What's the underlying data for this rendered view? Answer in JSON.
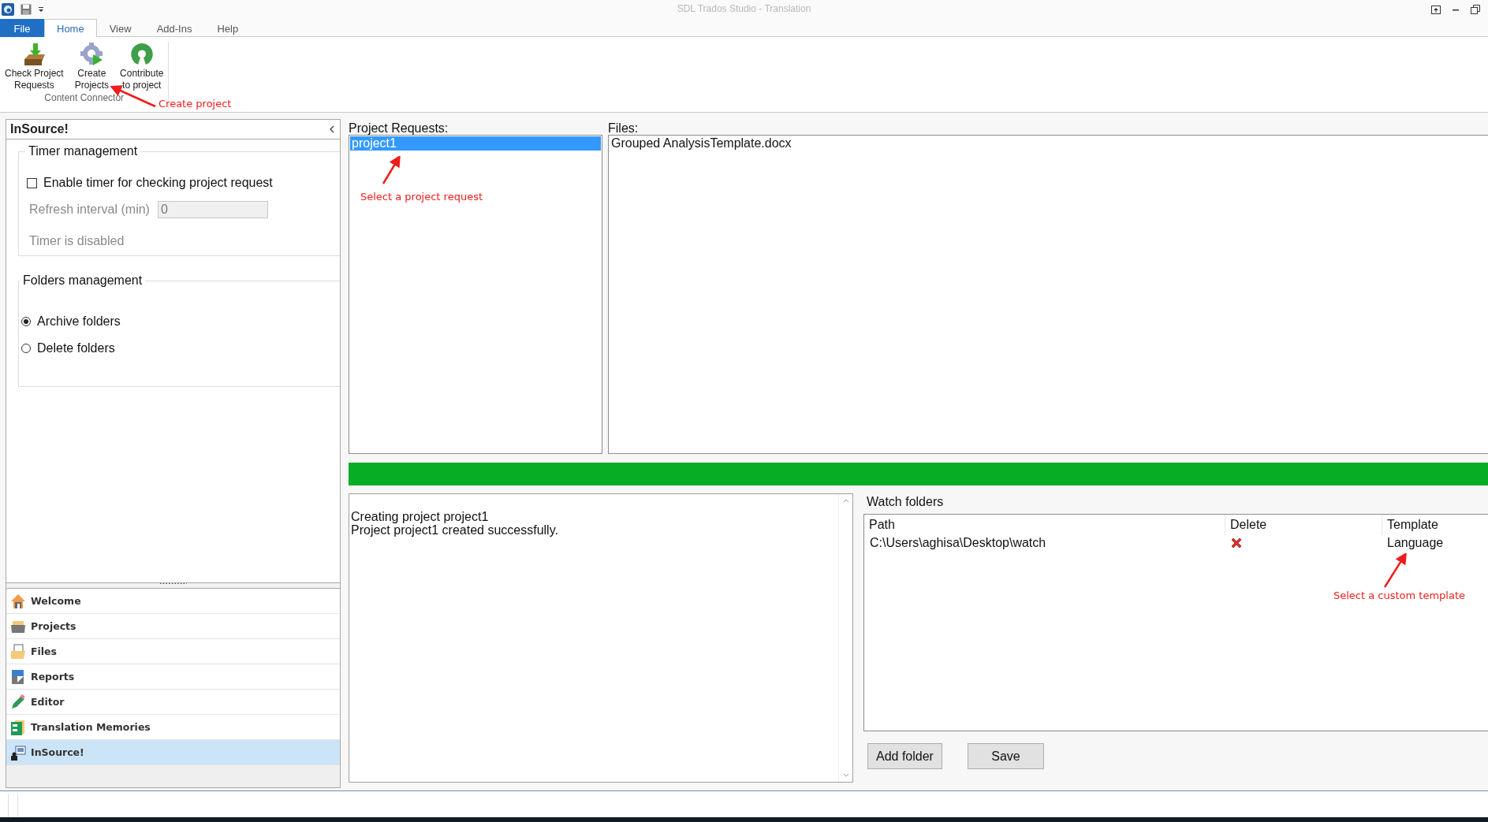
{
  "window": {
    "title": "SDL Trados Studio - Translation"
  },
  "ribbon": {
    "tabs": [
      {
        "label": "File",
        "kind": "file",
        "selected": false
      },
      {
        "label": "Home",
        "kind": "tab",
        "selected": true
      },
      {
        "label": "View",
        "kind": "tab",
        "selected": false
      },
      {
        "label": "Add-Ins",
        "kind": "tab",
        "selected": false
      },
      {
        "label": "Help",
        "kind": "tab",
        "selected": false
      }
    ],
    "groups": [
      {
        "label": "Content Connector",
        "buttons": [
          {
            "label": "Check Project\nRequests"
          },
          {
            "label": "Create\nProjects"
          },
          {
            "label": "Contribute\nto project"
          }
        ]
      }
    ]
  },
  "left_panel": {
    "title": "InSource!",
    "timer": {
      "title": "Timer management",
      "enable_timer": {
        "label": "Enable timer for checking project request",
        "checked": false
      },
      "interval": {
        "label": "Refresh interval (min)",
        "value": "0",
        "disabled": true
      },
      "status": "Timer is disabled"
    },
    "folders": {
      "title": "Folders management",
      "options": [
        {
          "label": "Archive folders",
          "selected": true
        },
        {
          "label": "Delete folders",
          "selected": false
        }
      ]
    }
  },
  "nav": {
    "items": [
      {
        "label": "Welcome",
        "selected": false
      },
      {
        "label": "Projects",
        "selected": false
      },
      {
        "label": "Files",
        "selected": false
      },
      {
        "label": "Reports",
        "selected": false
      },
      {
        "label": "Editor",
        "selected": false
      },
      {
        "label": "Translation Memories",
        "selected": false
      },
      {
        "label": "InSource!",
        "selected": true
      }
    ]
  },
  "project_requests": {
    "label": "Project Requests:",
    "items": [
      {
        "label": "project1",
        "selected": true
      }
    ]
  },
  "files": {
    "label": "Files:",
    "items": [
      "Grouped AnalysisTemplate.docx"
    ]
  },
  "progress": {
    "level": 1
  },
  "log": {
    "lines": [
      "Creating project project1",
      "Project project1 created successfully."
    ]
  },
  "watch_folders": {
    "title": "Watch folders",
    "columns": [
      "Path",
      "Delete",
      "Template"
    ],
    "rows": [
      {
        "path": "C:\\Users\\aghisa\\Desktop\\watch",
        "template": "Language"
      }
    ],
    "buttons": [
      "Add folder",
      "Save"
    ]
  },
  "annotations": [
    {
      "text": "Create project"
    },
    {
      "text": "Select a project request"
    },
    {
      "text": "Select a custom template"
    }
  ]
}
